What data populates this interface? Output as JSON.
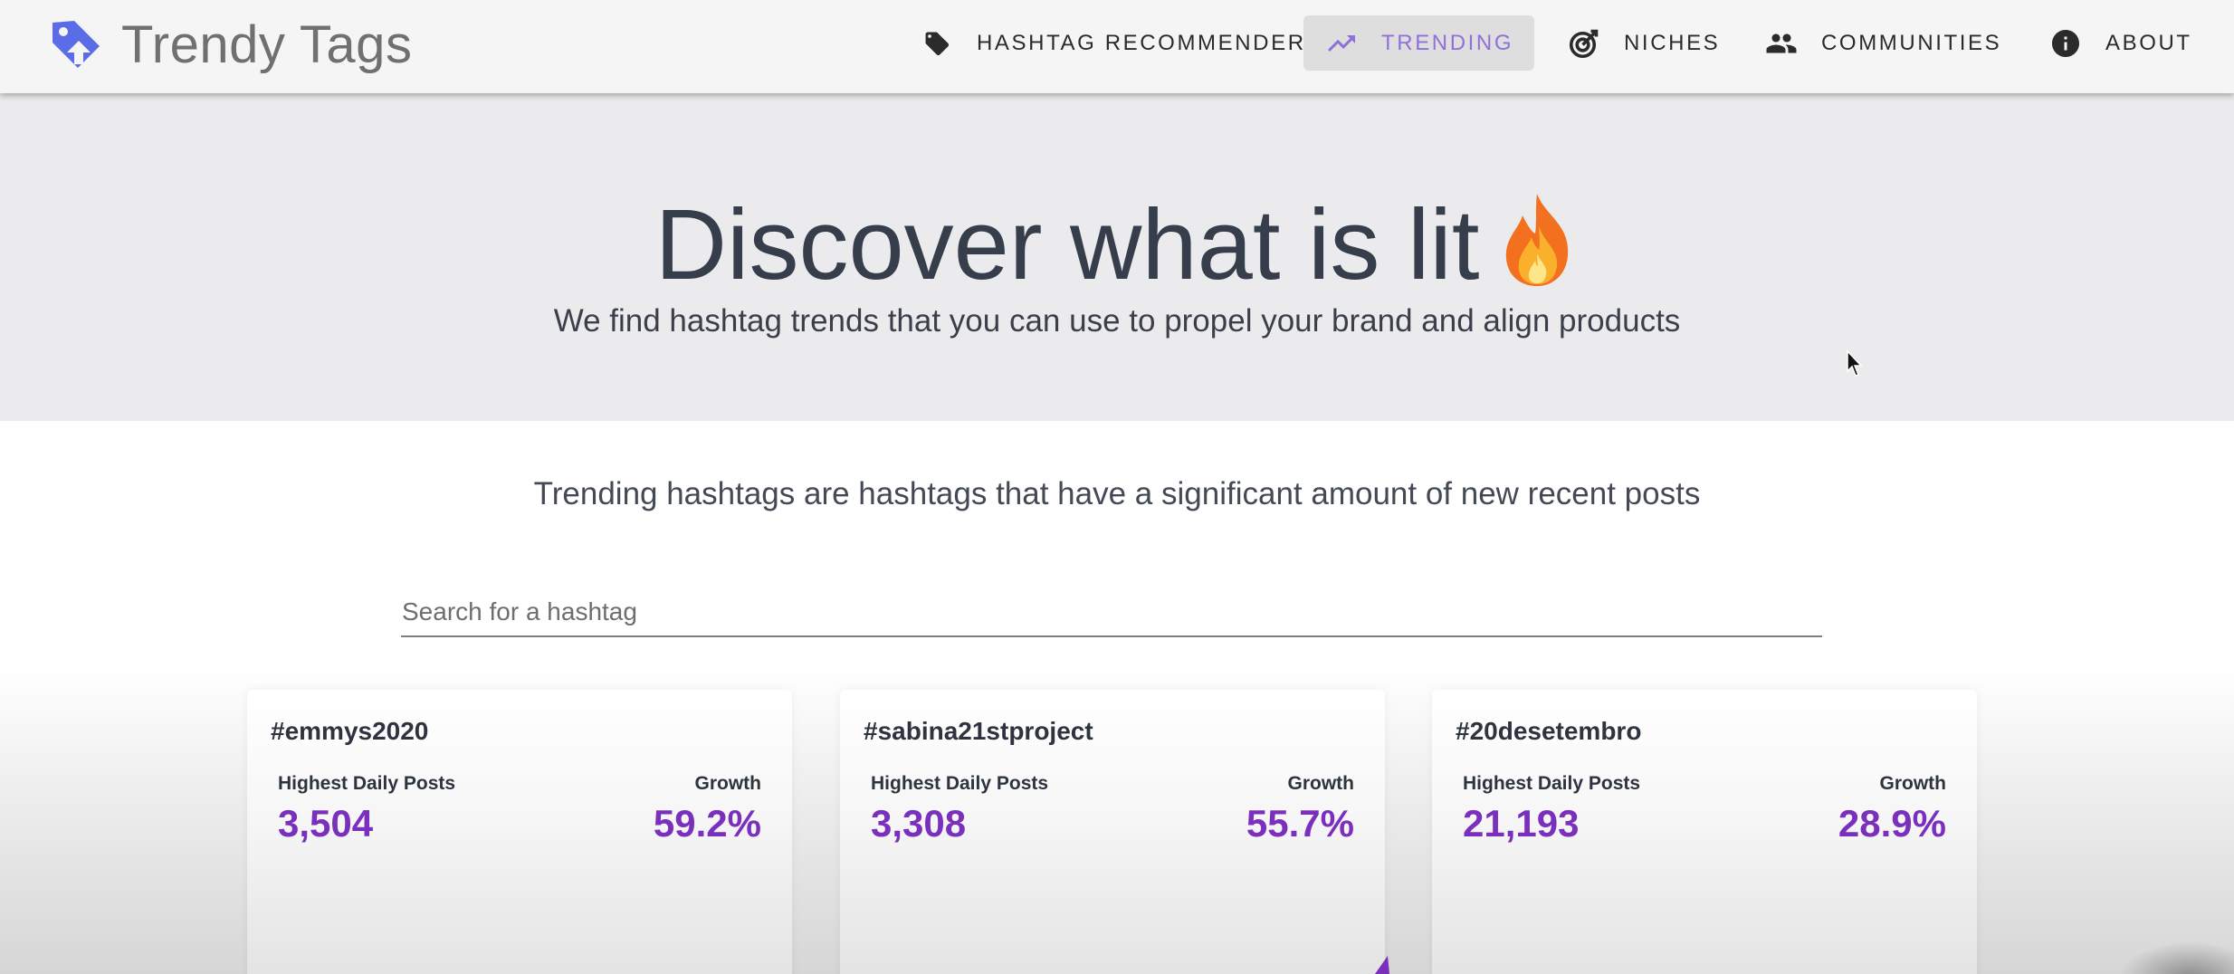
{
  "header": {
    "brand_name": "Trendy Tags",
    "brand_icon": "tag-arrow-logo-icon",
    "nav": [
      {
        "label": "HASHTAG RECOMMENDER",
        "icon": "tag-icon",
        "active": false
      },
      {
        "label": "TRENDING",
        "icon": "trending-up-icon",
        "active": true
      },
      {
        "label": "NICHES",
        "icon": "target-icon",
        "active": false
      },
      {
        "label": "COMMUNITIES",
        "icon": "people-icon",
        "active": false
      },
      {
        "label": "ABOUT",
        "icon": "info-icon",
        "active": false
      }
    ]
  },
  "hero": {
    "title": "Discover what is lit",
    "title_emoji_icon": "fire-icon",
    "subtitle": "We find hashtag trends that you can use to propel your brand and align products"
  },
  "main": {
    "intro": "Trending hashtags are hashtags that have a significant amount of new recent posts",
    "search": {
      "placeholder": "Search for a hashtag",
      "value": ""
    },
    "cards": [
      {
        "tag": "#emmys2020",
        "posts_label": "Highest Daily Posts",
        "posts": "3,504",
        "growth_label": "Growth",
        "growth": "59.2%"
      },
      {
        "tag": "#sabina21stproject",
        "posts_label": "Highest Daily Posts",
        "posts": "3,308",
        "growth_label": "Growth",
        "growth": "55.7%"
      },
      {
        "tag": "#20desetembro",
        "posts_label": "Highest Daily Posts",
        "posts": "21,193",
        "growth_label": "Growth",
        "growth": "28.9%"
      }
    ]
  },
  "colors": {
    "accent": "#7a2fbd",
    "nav_active_text": "#8e71d9",
    "logo": "#5b6de6",
    "hero_bg": "#ebebee"
  }
}
